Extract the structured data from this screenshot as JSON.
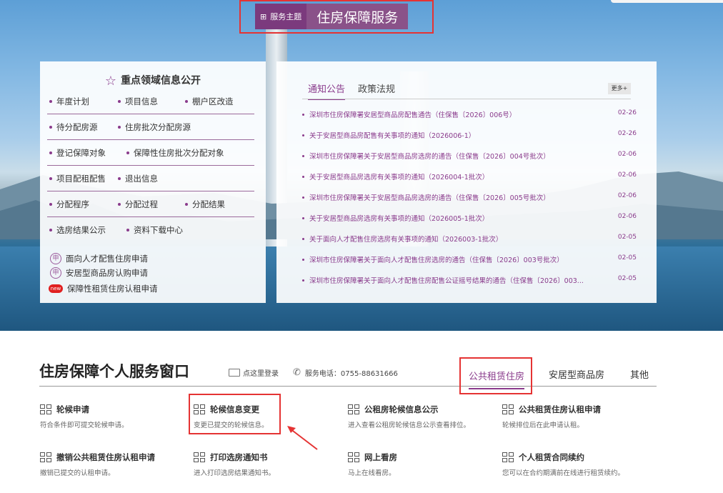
{
  "theme": {
    "tag": "服务主题",
    "title": "住房保障服务"
  },
  "focus": {
    "title": "重点领域信息公开",
    "rows": [
      [
        "年度计划",
        "项目信息",
        "棚户区改造"
      ],
      [
        "待分配房源",
        "住房批次分配房源"
      ],
      [
        "登记保障对象",
        "保障性住房批次分配对象"
      ],
      [
        "项目配租配售",
        "退出信息"
      ],
      [
        "分配程序",
        "分配过程",
        "分配结果"
      ],
      [
        "选房结果公示",
        "资料下载中心"
      ]
    ],
    "applies": [
      "面向人才配售住房申请",
      "安居型商品房认购申请",
      "保障性租赁住房认租申请"
    ],
    "new_badge": "new"
  },
  "notices": {
    "tabs": [
      "通知公告",
      "政策法规"
    ],
    "more": "更多+",
    "items": [
      {
        "text": "深圳市住房保障署安居型商品房配售通告（住保售〔2026〕006号）",
        "date": "02-26"
      },
      {
        "text": "关于安居型商品房配售有关事项的通知（2026006-1）",
        "date": "02-26"
      },
      {
        "text": "深圳市住房保障署关于安居型商品房选房的通告（住保售〔2026〕004号批次）",
        "date": "02-06"
      },
      {
        "text": "关于安居型商品房选房有关事项的通知（2026004-1批次）",
        "date": "02-06"
      },
      {
        "text": "深圳市住房保障署关于安居型商品房选房的通告（住保售〔2026〕005号批次）",
        "date": "02-06"
      },
      {
        "text": "关于安居型商品房选房有关事项的通知（2026005-1批次）",
        "date": "02-06"
      },
      {
        "text": "关于面向人才配售住房选房有关事项的通知（2026003-1批次）",
        "date": "02-05"
      },
      {
        "text": "深圳市住房保障署关于面向人才配售住房选房的通告（住保售〔2026〕003号批次）",
        "date": "02-05"
      },
      {
        "text": "深圳市住房保障署关于面向人才配售住房配售公证摇号结果的通告（住保售〔2026〕003...",
        "date": "02-05"
      }
    ]
  },
  "service": {
    "title": "住房保障个人服务窗口",
    "login": "点这里登录",
    "phone": "服务电话：0755-88631666",
    "tabs": [
      "公共租赁住房",
      "安居型商品房",
      "其他"
    ],
    "items": [
      {
        "title": "轮候申请",
        "desc": "符合条件即可提交轮候申请。"
      },
      {
        "title": "轮候信息变更",
        "desc": "变更已提交的轮候信息。"
      },
      {
        "title": "公租房轮候信息公示",
        "desc": "进入查看公租房轮候信息公示查看排位。"
      },
      {
        "title": "公共租赁住房认租申请",
        "desc": "轮候排位后在此申请认租。"
      },
      {
        "title": "撤销公共租赁住房认租申请",
        "desc": "撤销已提交的认租申请。"
      },
      {
        "title": "打印选房通知书",
        "desc": "进入打印选房结果通知书。"
      },
      {
        "title": "网上看房",
        "desc": "马上在线看房。"
      },
      {
        "title": "个人租赁合同续约",
        "desc": "您可以在合约期满前在线进行租赁续约。"
      }
    ]
  },
  "colors": {
    "accent": "#8a3b8c",
    "highlight": "#e53333"
  }
}
